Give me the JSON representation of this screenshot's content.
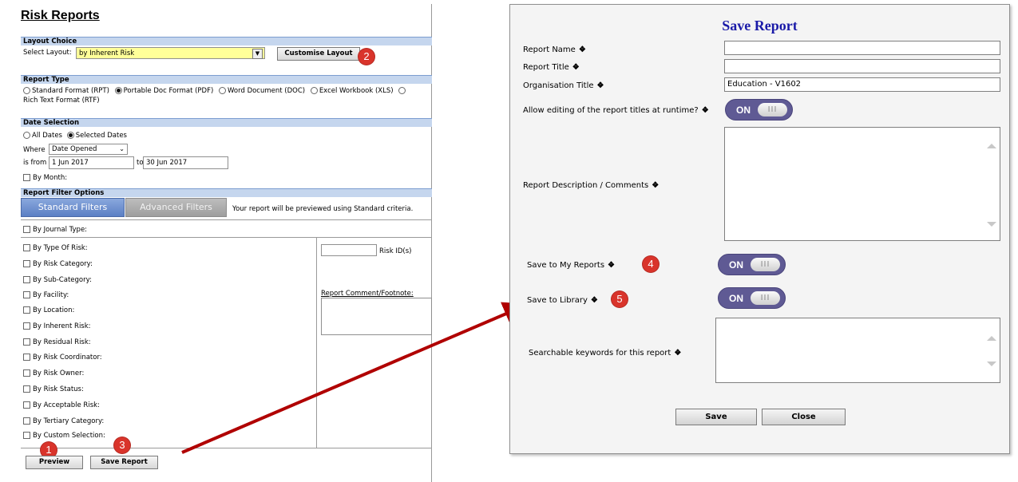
{
  "left": {
    "title": "Risk Reports",
    "layout_choice": {
      "header": "Layout Choice",
      "label": "Select Layout:",
      "value": "by Inherent Risk",
      "customise_button": "Customise Layout"
    },
    "report_type": {
      "header": "Report Type",
      "options": [
        "Standard Format (RPT)",
        "Portable Doc Format (PDF)",
        "Word Document (DOC)",
        "Excel Workbook (XLS)",
        "Rich Text Format (RTF)"
      ],
      "selected": "Portable Doc Format (PDF)"
    },
    "date_selection": {
      "header": "Date Selection",
      "all_dates": "All Dates",
      "selected_dates": "Selected Dates",
      "where_label": "Where",
      "where_value": "Date Opened",
      "from_label": "is from",
      "from_value": "1 Jun 2017",
      "to_label": "to",
      "to_value": "30 Jun 2017",
      "by_month": "By Month:"
    },
    "filters": {
      "header": "Report Filter Options",
      "standard_tab": "Standard Filters",
      "advanced_tab": "Advanced Filters",
      "preview_note": "Your report will be previewed using Standard criteria.",
      "journal_type": "By Journal Type:",
      "items": [
        "By Type Of Risk:",
        "By Risk Category:",
        "By Sub-Category:",
        "By Facility:",
        "By Location:",
        "By Inherent Risk:",
        "By Residual Risk:",
        "By Risk Coordinator:",
        "By Risk Owner:",
        "By Risk Status:",
        "By Acceptable Risk:",
        "By Tertiary Category:",
        "By Custom Selection:"
      ],
      "risk_id_label": "Risk ID(s)",
      "comment_label": "Report Comment/Footnote:"
    },
    "preview_button": "Preview",
    "save_report_button": "Save Report",
    "badges": [
      "1",
      "2",
      "3"
    ]
  },
  "dialog": {
    "title": "Save Report",
    "report_name_label": "Report Name",
    "report_name_value": "",
    "report_title_label": "Report Title",
    "report_title_value": "",
    "org_title_label": "Organisation Title",
    "org_title_value": "Education - V1602",
    "allow_editing_label": "Allow editing of the report titles at runtime?",
    "description_label": "Report Description / Comments",
    "save_my_reports_label": "Save to My Reports",
    "save_library_label": "Save to Library",
    "keywords_label": "Searchable keywords for this report",
    "toggle_on": "ON",
    "toggle_knob": "III",
    "save_button": "Save",
    "close_button": "Close",
    "badges": [
      "4",
      "5"
    ]
  },
  "colors": {
    "accent_title": "#1a1aa8",
    "badge": "#d9342b",
    "arrow": "#b00000",
    "toggle": "#5f5a94",
    "section_header": "#c5d6ee"
  }
}
